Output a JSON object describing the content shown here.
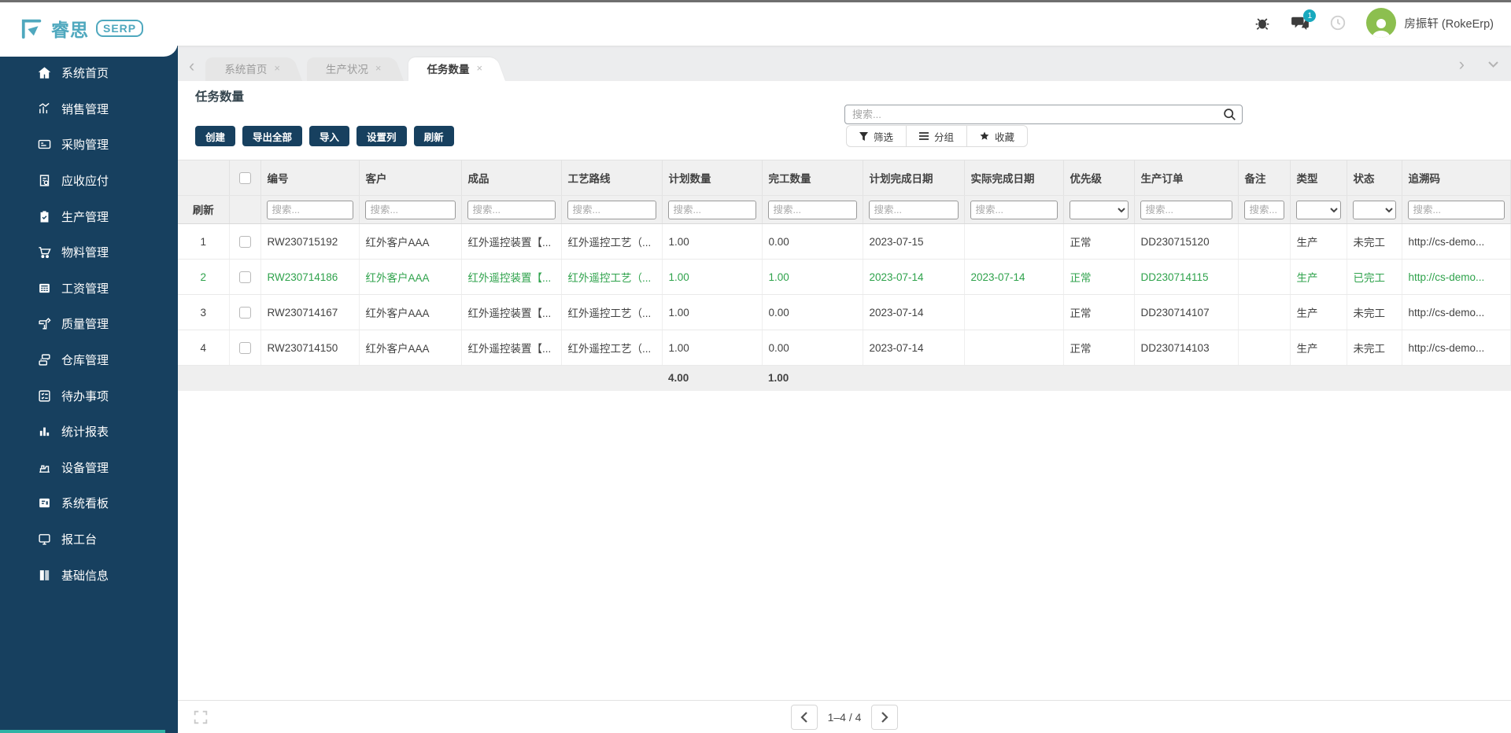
{
  "brand": {
    "name": "睿思",
    "badge": "SERP"
  },
  "header": {
    "user": "房振轩 (RokeErp)",
    "message_badge": "1",
    "icons": [
      "bug-icon",
      "messages-icon",
      "clock-icon",
      "avatar"
    ]
  },
  "colors": {
    "sidebar_navy": "#17405F",
    "brand_teal": "#4FA8BE",
    "row_green": "#2EA24B",
    "avatar_green": "#8CBF4F",
    "badge_teal": "#18A9BE"
  },
  "sidebar": {
    "items": [
      {
        "icon": "home-icon",
        "label": "系统首页"
      },
      {
        "icon": "sales-chart-icon",
        "label": "销售管理"
      },
      {
        "icon": "purchase-icon",
        "label": "采购管理"
      },
      {
        "icon": "receivable-icon",
        "label": "应收应付"
      },
      {
        "icon": "production-icon",
        "label": "生产管理"
      },
      {
        "icon": "material-cart-icon",
        "label": "物料管理"
      },
      {
        "icon": "salary-icon",
        "label": "工资管理"
      },
      {
        "icon": "quality-icon",
        "label": "质量管理"
      },
      {
        "icon": "warehouse-icon",
        "label": "仓库管理"
      },
      {
        "icon": "todo-icon",
        "label": "待办事项"
      },
      {
        "icon": "report-chart-icon",
        "label": "统计报表"
      },
      {
        "icon": "equipment-icon",
        "label": "设备管理"
      },
      {
        "icon": "kanban-icon",
        "label": "系统看板"
      },
      {
        "icon": "workstation-icon",
        "label": "报工台"
      },
      {
        "icon": "basic-info-icon",
        "label": "基础信息"
      }
    ]
  },
  "tabs": [
    {
      "label": "系统首页",
      "close": "×",
      "active": false
    },
    {
      "label": "生产状况",
      "close": "×",
      "active": false
    },
    {
      "label": "任务数量",
      "close": "×",
      "active": true
    }
  ],
  "page": {
    "title": "任务数量"
  },
  "toolbar": {
    "buttons": [
      "创建",
      "导出全部",
      "导入",
      "设置列",
      "刷新"
    ]
  },
  "search": {
    "placeholder": "搜索..."
  },
  "view_controls": [
    {
      "icon": "filter-icon",
      "label": "筛选"
    },
    {
      "icon": "group-icon",
      "label": "分组"
    },
    {
      "icon": "star-icon",
      "label": "收藏"
    }
  ],
  "table": {
    "corner_label": "刷新",
    "filter_placeholder": "搜索...",
    "columns": [
      "编号",
      "客户",
      "成品",
      "工艺路线",
      "计划数量",
      "完工数量",
      "计划完成日期",
      "实际完成日期",
      "优先级",
      "生产订单",
      "备注",
      "类型",
      "状态",
      "追溯码"
    ],
    "rows": [
      {
        "num": "1",
        "id": "RW230715192",
        "customer": "红外客户AAA",
        "product": "红外遥控装置【...",
        "route": "红外遥控工艺（...",
        "plan_qty": "1.00",
        "done_qty": "0.00",
        "plan_date": "2023-07-15",
        "actual_date": "",
        "priority": "正常",
        "order": "DD230715120",
        "remark": "",
        "type": "生产",
        "status": "未完工",
        "trace": "http://cs-demo...",
        "highlighted": false
      },
      {
        "num": "2",
        "id": "RW230714186",
        "customer": "红外客户AAA",
        "product": "红外遥控装置【...",
        "route": "红外遥控工艺（...",
        "plan_qty": "1.00",
        "done_qty": "1.00",
        "plan_date": "2023-07-14",
        "actual_date": "2023-07-14",
        "priority": "正常",
        "order": "DD230714115",
        "remark": "",
        "type": "生产",
        "status": "已完工",
        "trace": "http://cs-demo...",
        "highlighted": true
      },
      {
        "num": "3",
        "id": "RW230714167",
        "customer": "红外客户AAA",
        "product": "红外遥控装置【...",
        "route": "红外遥控工艺（...",
        "plan_qty": "1.00",
        "done_qty": "0.00",
        "plan_date": "2023-07-14",
        "actual_date": "",
        "priority": "正常",
        "order": "DD230714107",
        "remark": "",
        "type": "生产",
        "status": "未完工",
        "trace": "http://cs-demo...",
        "highlighted": false
      },
      {
        "num": "4",
        "id": "RW230714150",
        "customer": "红外客户AAA",
        "product": "红外遥控装置【...",
        "route": "红外遥控工艺（...",
        "plan_qty": "1.00",
        "done_qty": "0.00",
        "plan_date": "2023-07-14",
        "actual_date": "",
        "priority": "正常",
        "order": "DD230714103",
        "remark": "",
        "type": "生产",
        "status": "未完工",
        "trace": "http://cs-demo...",
        "highlighted": false
      }
    ],
    "totals": {
      "plan_qty": "4.00",
      "done_qty": "1.00"
    }
  },
  "pagination": {
    "range": "1–4 / 4"
  }
}
